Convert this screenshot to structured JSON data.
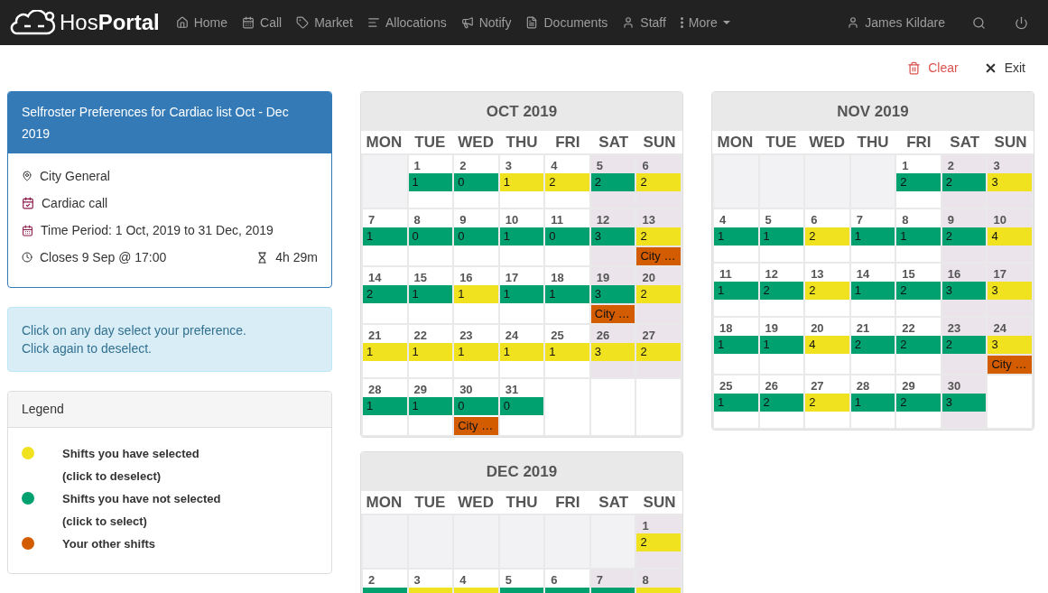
{
  "navbar": {
    "brand": "Hos**Portal**",
    "items": [
      {
        "kind": "home",
        "label": "Home"
      },
      {
        "kind": "call",
        "label": "Call"
      },
      {
        "kind": "market",
        "label": "Market"
      },
      {
        "kind": "allocations",
        "label": "Allocations"
      },
      {
        "kind": "notify",
        "label": "Notify"
      },
      {
        "kind": "documents",
        "label": "Documents"
      },
      {
        "kind": "staff",
        "label": "Staff"
      },
      {
        "kind": "more",
        "label": "More"
      }
    ],
    "user": "James Kildare"
  },
  "toolbar": {
    "clear": "Clear",
    "exit": "Exit"
  },
  "info_card": {
    "title": "Selfroster Preferences for Cardiac list Oct - Dec 2019",
    "location": "City General",
    "list": "Cardiac call",
    "period": "Time Period: 1 Oct, 2019 to 31 Dec, 2019",
    "closes": "Closes 9 Sep @ 17:00",
    "remaining": "4h 29m"
  },
  "hint": [
    "Click on any day select your preference.",
    "Click again to deselect."
  ],
  "legend": {
    "title": "Legend",
    "items": [
      {
        "color": "#f0e21f",
        "label": "Shifts you have selected",
        "note": "(click to deselect)"
      },
      {
        "color": "#00a06f",
        "label": "Shifts you have not selected",
        "note": "(click to select)"
      },
      {
        "color": "#d35c00",
        "label": "Your other shifts"
      }
    ]
  },
  "months": [
    {
      "title": "OCT 2019",
      "weekdays": [
        "MON",
        "TUE",
        "WED",
        "THU",
        "FRI",
        "SAT",
        "SUN"
      ],
      "weeks": [
        {
          "days": [
            {
              "kind": "empty"
            },
            {
              "number": "1",
              "shift": {
                "count": "1",
                "selected": false
              }
            },
            {
              "number": "2",
              "shift": {
                "count": "0",
                "selected": false
              }
            },
            {
              "number": "3",
              "shift": {
                "count": "1",
                "selected": true
              }
            },
            {
              "number": "4",
              "shift": {
                "count": "2",
                "selected": true
              }
            },
            {
              "number": "5",
              "shift": {
                "count": "2",
                "selected": false
              }
            },
            {
              "number": "6",
              "shift": {
                "count": "2",
                "selected": true
              }
            }
          ]
        },
        {
          "days": [
            {
              "number": "7",
              "shift": {
                "count": "1",
                "selected": false
              }
            },
            {
              "number": "8",
              "shift": {
                "count": "0",
                "selected": false
              }
            },
            {
              "number": "9",
              "shift": {
                "count": "0",
                "selected": false
              }
            },
            {
              "number": "10",
              "shift": {
                "count": "1",
                "selected": false
              }
            },
            {
              "number": "11",
              "shift": {
                "count": "0",
                "selected": false
              }
            },
            {
              "number": "12",
              "shift": {
                "count": "3",
                "selected": false
              }
            },
            {
              "number": "13",
              "shift": {
                "count": "2",
                "selected": true
              },
              "other": "City …"
            }
          ]
        },
        {
          "days": [
            {
              "number": "14",
              "shift": {
                "count": "2",
                "selected": false
              }
            },
            {
              "number": "15",
              "shift": {
                "count": "1",
                "selected": false
              }
            },
            {
              "number": "16",
              "shift": {
                "count": "1",
                "selected": true
              }
            },
            {
              "number": "17",
              "shift": {
                "count": "1",
                "selected": false
              }
            },
            {
              "number": "18",
              "shift": {
                "count": "1",
                "selected": false
              }
            },
            {
              "number": "19",
              "shift": {
                "count": "3",
                "selected": false
              },
              "other": "City …"
            },
            {
              "number": "20",
              "shift": {
                "count": "2",
                "selected": true
              }
            }
          ]
        },
        {
          "days": [
            {
              "number": "21",
              "shift": {
                "count": "1",
                "selected": true
              }
            },
            {
              "number": "22",
              "shift": {
                "count": "1",
                "selected": true
              }
            },
            {
              "number": "23",
              "shift": {
                "count": "1",
                "selected": true
              }
            },
            {
              "number": "24",
              "shift": {
                "count": "1",
                "selected": true
              }
            },
            {
              "number": "25",
              "shift": {
                "count": "1",
                "selected": true
              }
            },
            {
              "number": "26",
              "shift": {
                "count": "3",
                "selected": true
              }
            },
            {
              "number": "27",
              "shift": {
                "count": "2",
                "selected": true
              }
            }
          ]
        },
        {
          "days": [
            {
              "number": "28",
              "shift": {
                "count": "1",
                "selected": false
              }
            },
            {
              "number": "29",
              "shift": {
                "count": "1",
                "selected": false
              }
            },
            {
              "number": "30",
              "shift": {
                "count": "0",
                "selected": false
              },
              "other": "City …"
            },
            {
              "number": "31",
              "shift": {
                "count": "0",
                "selected": false
              }
            }
          ]
        }
      ]
    },
    {
      "title": "DEC 2019",
      "weekdays": [
        "MON",
        "TUE",
        "WED",
        "THU",
        "FRI",
        "SAT",
        "SUN"
      ],
      "weeks": [
        {
          "days": [
            {
              "kind": "empty"
            },
            {
              "kind": "empty"
            },
            {
              "kind": "empty"
            },
            {
              "kind": "empty"
            },
            {
              "kind": "empty"
            },
            {
              "kind": "empty"
            },
            {
              "number": "1",
              "shift": {
                "count": "2",
                "selected": true
              }
            }
          ]
        },
        {
          "days": [
            {
              "number": "2",
              "shift": {
                "selected": false
              }
            },
            {
              "number": "3",
              "shift": {
                "selected": true
              }
            },
            {
              "number": "4",
              "shift": {
                "selected": true
              }
            },
            {
              "number": "5",
              "shift": {
                "selected": false
              }
            },
            {
              "number": "6",
              "shift": {
                "selected": false
              }
            },
            {
              "number": "7",
              "shift": {
                "selected": false
              }
            },
            {
              "number": "8",
              "shift": {
                "selected": true
              }
            }
          ]
        }
      ]
    },
    {
      "title": "NOV 2019",
      "weekdays": [
        "MON",
        "TUE",
        "WED",
        "THU",
        "FRI",
        "SAT",
        "SUN"
      ],
      "weeks": [
        {
          "days": [
            {
              "kind": "empty"
            },
            {
              "kind": "empty"
            },
            {
              "kind": "empty"
            },
            {
              "kind": "empty"
            },
            {
              "number": "1",
              "shift": {
                "count": "2",
                "selected": false
              }
            },
            {
              "number": "2",
              "shift": {
                "count": "2",
                "selected": false
              }
            },
            {
              "number": "3",
              "shift": {
                "count": "3",
                "selected": true
              }
            }
          ]
        },
        {
          "days": [
            {
              "number": "4",
              "shift": {
                "count": "1",
                "selected": false
              }
            },
            {
              "number": "5",
              "shift": {
                "count": "1",
                "selected": false
              }
            },
            {
              "number": "6",
              "shift": {
                "count": "2",
                "selected": true
              }
            },
            {
              "number": "7",
              "shift": {
                "count": "1",
                "selected": false
              }
            },
            {
              "number": "8",
              "shift": {
                "count": "1",
                "selected": false
              }
            },
            {
              "number": "9",
              "shift": {
                "count": "2",
                "selected": false
              }
            },
            {
              "number": "10",
              "shift": {
                "count": "4",
                "selected": true
              }
            }
          ]
        },
        {
          "days": [
            {
              "number": "11",
              "shift": {
                "count": "1",
                "selected": false
              }
            },
            {
              "number": "12",
              "shift": {
                "count": "2",
                "selected": false
              }
            },
            {
              "number": "13",
              "shift": {
                "count": "2",
                "selected": true
              }
            },
            {
              "number": "14",
              "shift": {
                "count": "1",
                "selected": false
              }
            },
            {
              "number": "15",
              "shift": {
                "count": "2",
                "selected": false
              }
            },
            {
              "number": "16",
              "shift": {
                "count": "3",
                "selected": false
              }
            },
            {
              "number": "17",
              "shift": {
                "count": "3",
                "selected": true
              }
            }
          ]
        },
        {
          "days": [
            {
              "number": "18",
              "shift": {
                "count": "1",
                "selected": false
              }
            },
            {
              "number": "19",
              "shift": {
                "count": "1",
                "selected": false
              }
            },
            {
              "number": "20",
              "shift": {
                "count": "4",
                "selected": true
              }
            },
            {
              "number": "21",
              "shift": {
                "count": "2",
                "selected": false
              }
            },
            {
              "number": "22",
              "shift": {
                "count": "2",
                "selected": false
              }
            },
            {
              "number": "23",
              "shift": {
                "count": "2",
                "selected": false
              }
            },
            {
              "number": "24",
              "shift": {
                "count": "3",
                "selected": true
              },
              "other": "City …"
            }
          ]
        },
        {
          "days": [
            {
              "number": "25",
              "shift": {
                "count": "1",
                "selected": false
              }
            },
            {
              "number": "26",
              "shift": {
                "count": "2",
                "selected": false
              }
            },
            {
              "number": "27",
              "shift": {
                "count": "2",
                "selected": true
              }
            },
            {
              "number": "28",
              "shift": {
                "count": "1",
                "selected": false
              }
            },
            {
              "number": "29",
              "shift": {
                "count": "2",
                "selected": false
              }
            },
            {
              "number": "30",
              "shift": {
                "count": "3",
                "selected": false
              }
            }
          ]
        }
      ]
    }
  ]
}
